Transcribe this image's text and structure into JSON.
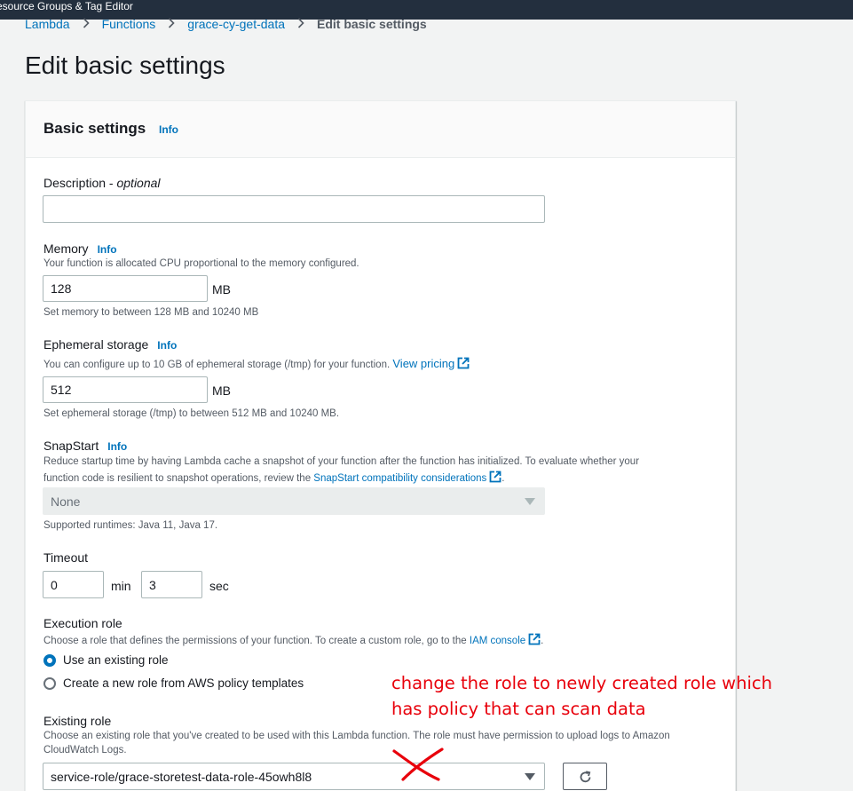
{
  "topbar": {
    "text": "esource Groups & Tag Editor"
  },
  "breadcrumb": {
    "items": [
      "Lambda",
      "Functions",
      "grace-cy-get-data"
    ],
    "current": "Edit basic settings"
  },
  "page": {
    "title": "Edit basic settings"
  },
  "panel": {
    "title": "Basic settings",
    "info": "Info"
  },
  "description": {
    "label": "Description",
    "label_suffix": " - ",
    "optional": "optional",
    "value": ""
  },
  "memory": {
    "label": "Memory",
    "info": "Info",
    "desc": "Your function is allocated CPU proportional to the memory configured.",
    "value": "128",
    "unit": "MB",
    "hint": "Set memory to between 128 MB and 10240 MB"
  },
  "ephemeral": {
    "label": "Ephemeral storage",
    "info": "Info",
    "desc": "You can configure up to 10 GB of ephemeral storage (/tmp) for your function.",
    "link": "View pricing",
    "value": "512",
    "unit": "MB",
    "hint": "Set ephemeral storage (/tmp) to between 512 MB and 10240 MB."
  },
  "snapstart": {
    "label": "SnapStart",
    "info": "Info",
    "desc_line1": "Reduce startup time by having Lambda cache a snapshot of your function after the function has initialized. To evaluate whether your",
    "desc_line2": "function code is resilient to snapshot operations, review the",
    "link": "SnapStart compatibility considerations",
    "desc_end": ".",
    "selected": "None",
    "hint": "Supported runtimes: Java 11, Java 17."
  },
  "timeout": {
    "label": "Timeout",
    "min_value": "0",
    "min_unit": "min",
    "sec_value": "3",
    "sec_unit": "sec"
  },
  "execution_role": {
    "label": "Execution role",
    "desc": "Choose a role that defines the permissions of your function. To create a custom role, go to the",
    "link": "IAM console",
    "desc_end": ".",
    "option_existing": "Use an existing role",
    "option_new": "Create a new role from AWS policy templates"
  },
  "existing_role": {
    "label": "Existing role",
    "desc_line1": "Choose an existing role that you've created to be used with this Lambda function. The role must have permission to upload logs to Amazon",
    "desc_line2": "CloudWatch Logs.",
    "selected": "service-role/grace-storetest-data-role-45owh8l8"
  },
  "annotation": {
    "line1": "change the role to newly created role which",
    "line2": "has policy that can scan data",
    "color": "#e8000b"
  },
  "colors": {
    "link": "#0073bb",
    "topbar": "#232f3e",
    "text": "#16191f",
    "muted": "#545b64"
  },
  "icons": {
    "breadcrumb_separator": "chevron-right-icon",
    "external": "external-link-icon",
    "dropdown": "caret-down-icon",
    "refresh": "refresh-icon",
    "annotation_mark": "red-x-mark-icon"
  }
}
